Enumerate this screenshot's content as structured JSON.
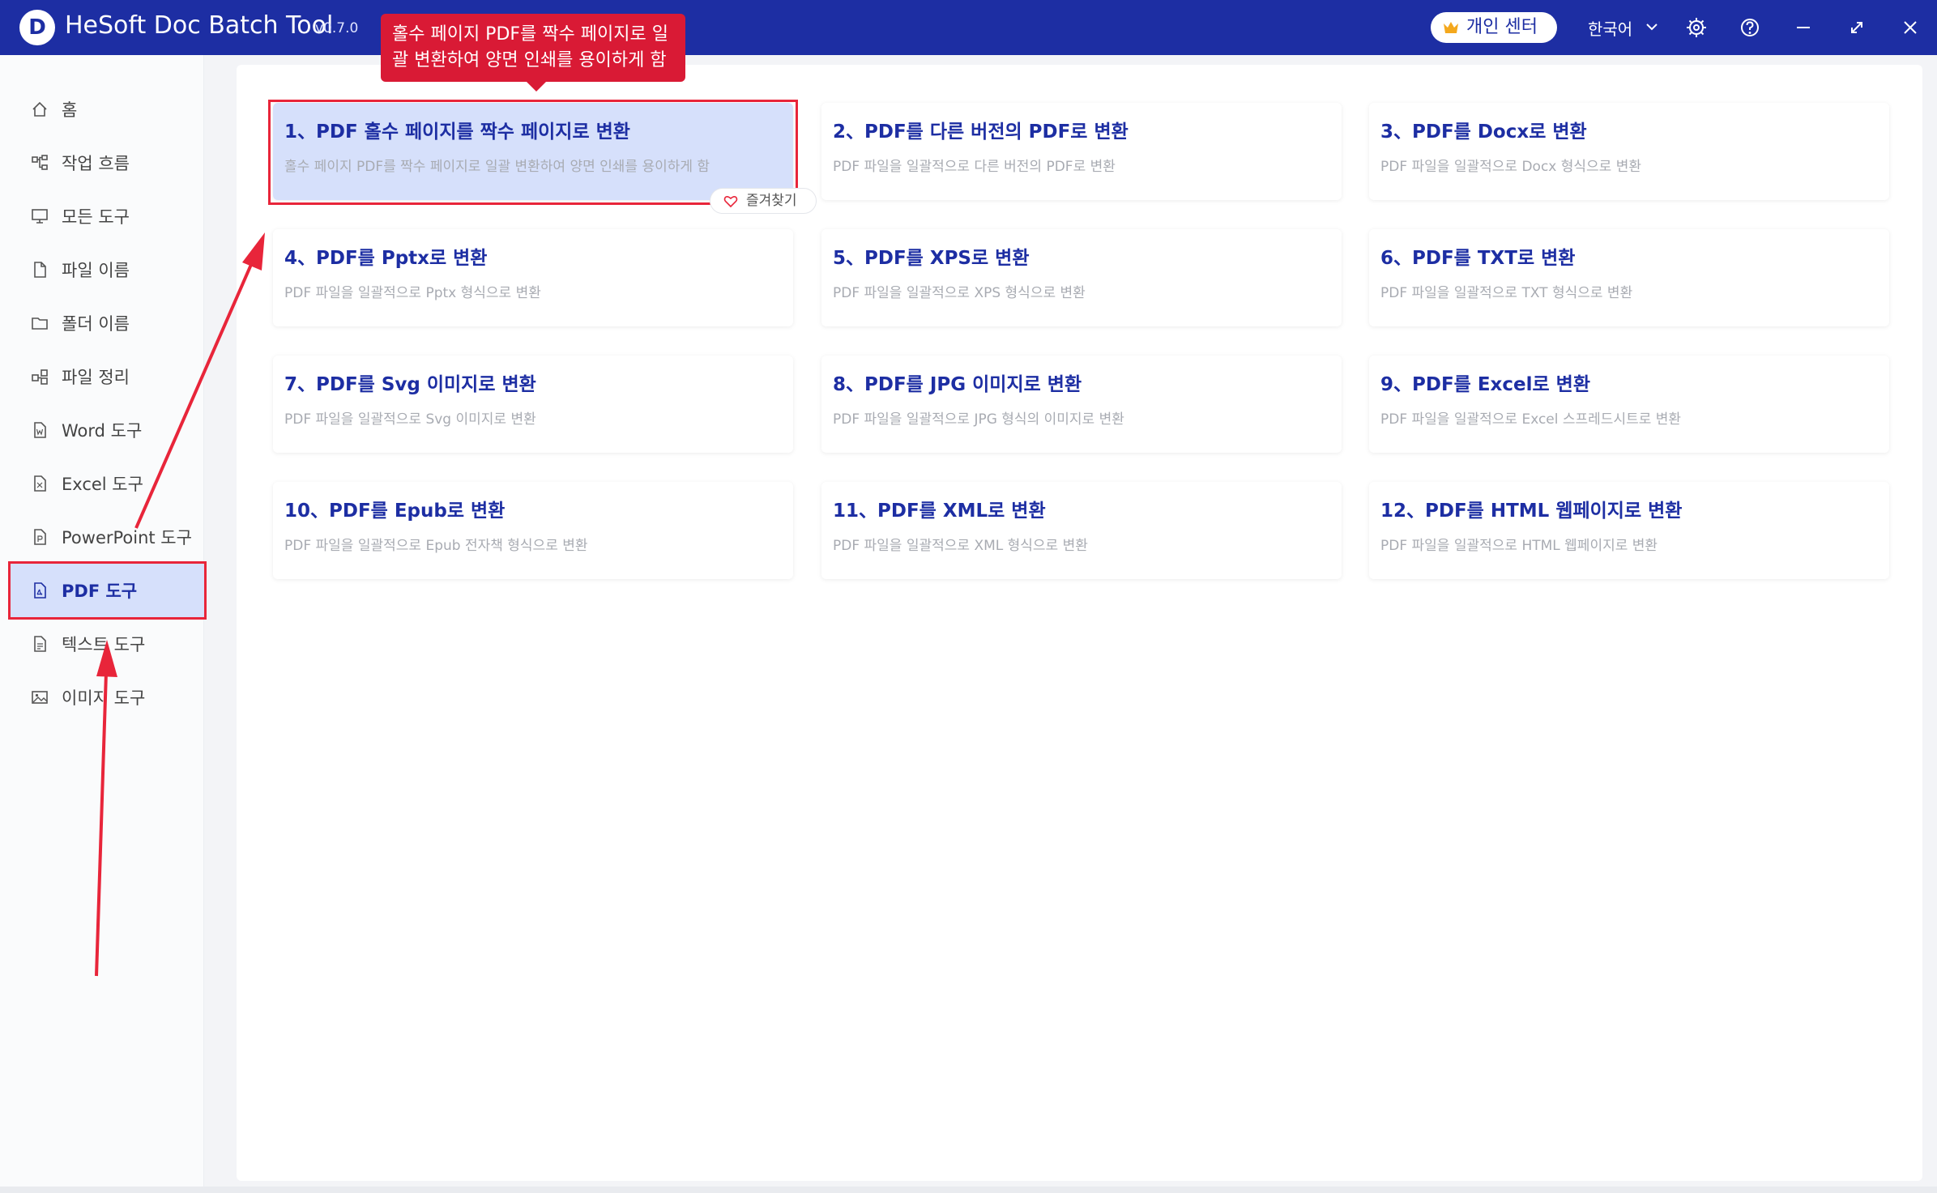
{
  "app": {
    "title": "HeSoft Doc Batch Tool",
    "version": "v0.7.0",
    "personal_center": "개인 센터",
    "language": "한국어"
  },
  "tooltip": {
    "text": "홀수 페이지 PDF를 짝수 페이지로 일괄 변환하여 양면 인쇄를 용이하게 함"
  },
  "sidebar": {
    "items": [
      {
        "label": "홈",
        "icon": "home-icon"
      },
      {
        "label": "작업 흐름",
        "icon": "workflow-icon"
      },
      {
        "label": "모든 도구",
        "icon": "monitor-icon"
      },
      {
        "label": "파일 이름",
        "icon": "file-icon"
      },
      {
        "label": "폴더 이름",
        "icon": "folder-icon"
      },
      {
        "label": "파일 정리",
        "icon": "organize-icon"
      },
      {
        "label": "Word 도구",
        "icon": "word-icon"
      },
      {
        "label": "Excel 도구",
        "icon": "excel-icon"
      },
      {
        "label": "PowerPoint 도구",
        "icon": "powerpoint-icon"
      },
      {
        "label": "PDF 도구",
        "icon": "pdf-icon",
        "active": true
      },
      {
        "label": "텍스트 도구",
        "icon": "text-icon"
      },
      {
        "label": "이미지 도구",
        "icon": "image-icon"
      }
    ]
  },
  "cards": [
    {
      "title": "1、PDF 홀수 페이지를 짝수 페이지로 변환",
      "desc": "홀수 페이지 PDF를 짝수 페이지로 일괄 변환하여 양면 인쇄를 용이하게 함",
      "highlighted": true
    },
    {
      "title": "2、PDF를 다른 버전의 PDF로 변환",
      "desc": "PDF 파일을 일괄적으로 다른 버전의 PDF로 변환"
    },
    {
      "title": "3、PDF를 Docx로 변환",
      "desc": "PDF 파일을 일괄적으로 Docx 형식으로 변환"
    },
    {
      "title": "4、PDF를 Pptx로 변환",
      "desc": "PDF 파일을 일괄적으로 Pptx 형식으로 변환"
    },
    {
      "title": "5、PDF를 XPS로 변환",
      "desc": "PDF 파일을 일괄적으로 XPS 형식으로 변환"
    },
    {
      "title": "6、PDF를 TXT로 변환",
      "desc": "PDF 파일을 일괄적으로 TXT 형식으로 변환"
    },
    {
      "title": "7、PDF를 Svg 이미지로 변환",
      "desc": "PDF 파일을 일괄적으로 Svg 이미지로 변환"
    },
    {
      "title": "8、PDF를 JPG 이미지로 변환",
      "desc": "PDF 파일을 일괄적으로 JPG 형식의 이미지로 변환"
    },
    {
      "title": "9、PDF를 Excel로 변환",
      "desc": "PDF 파일을 일괄적으로 Excel 스프레드시트로 변환"
    },
    {
      "title": "10、PDF를 Epub로 변환",
      "desc": "PDF 파일을 일괄적으로 Epub 전자책 형식으로 변환"
    },
    {
      "title": "11、PDF를 XML로 변환",
      "desc": "PDF 파일을 일괄적으로 XML 형식으로 변환"
    },
    {
      "title": "12、PDF를 HTML 웹페이지로 변환",
      "desc": "PDF 파일을 일괄적으로 HTML 웹페이지로 변환"
    }
  ],
  "favorite": {
    "label": "즐겨찾기"
  },
  "colors": {
    "brand": "#1d2ea3",
    "accent_red": "#e8253a",
    "highlight": "#d6e0fb"
  }
}
